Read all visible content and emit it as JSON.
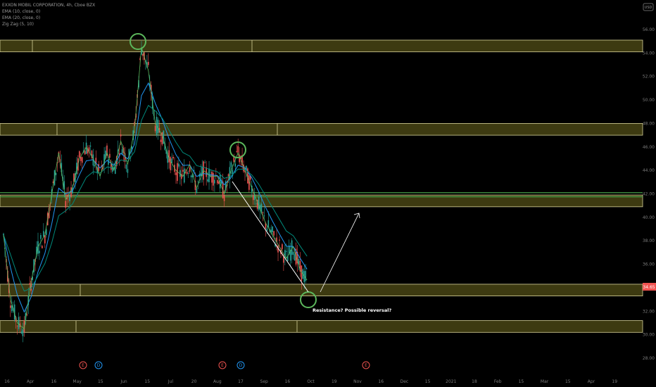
{
  "legend": {
    "symbol": "EXXON MOBIL CORPORATION, 4h, Cboe BZX",
    "ind1": "EMA (10, close, 0)",
    "ind2": "EMA (20, close, 0)",
    "ind3": "Zig Zag (5, 10)"
  },
  "currency_badge": "USD",
  "colors": {
    "zone_fill": "#3d3a11",
    "zone_border": "#d9d49a",
    "green_band": "#4caf50",
    "up_candle": "#26a69a",
    "down_candle": "#ef5350",
    "price_tag": "#ef5350",
    "zigzag": "#5cb85c",
    "ema1": "#2196f3",
    "ema2": "#00897b",
    "annotation": "#ffffff"
  },
  "chart_data": {
    "type": "candlestick",
    "title": "EXXON MOBIL CORPORATION, 4h, Cboe BZX",
    "ylim": [
      27,
      57.5
    ],
    "y_ticks": [
      "56.00",
      "54.00",
      "52.00",
      "50.00",
      "48.00",
      "46.00",
      "44.00",
      "42.00",
      "40.00",
      "38.00",
      "36.00",
      "34.00",
      "32.00",
      "30.00",
      "28.00"
    ],
    "x_ticks": [
      "16",
      "Apr",
      "16",
      "May",
      "15",
      "Jun",
      "15",
      "Jul",
      "20",
      "Aug",
      "17",
      "Sep",
      "16",
      "Oct",
      "19",
      "Nov",
      "16",
      "Dec",
      "15",
      "2021",
      "18",
      "Feb",
      "15",
      "Mar",
      "15",
      "Apr",
      "19"
    ],
    "last_price": "34.65",
    "price_path": [
      {
        "x": 0,
        "y": 38.5
      },
      {
        "x": 1,
        "y": 33.0
      },
      {
        "x": 2,
        "y": 31.0
      },
      {
        "x": 3,
        "y": 30.5
      },
      {
        "x": 4,
        "y": 34.5
      },
      {
        "x": 5,
        "y": 37.5
      },
      {
        "x": 6,
        "y": 38.5
      },
      {
        "x": 7,
        "y": 42.0
      },
      {
        "x": 8,
        "y": 45.5
      },
      {
        "x": 9,
        "y": 41.5
      },
      {
        "x": 10,
        "y": 42.5
      },
      {
        "x": 11,
        "y": 45.0
      },
      {
        "x": 12,
        "y": 46.0
      },
      {
        "x": 13,
        "y": 45.0
      },
      {
        "x": 14,
        "y": 43.5
      },
      {
        "x": 15,
        "y": 45.5
      },
      {
        "x": 16,
        "y": 44.0
      },
      {
        "x": 17,
        "y": 46.5
      },
      {
        "x": 18,
        "y": 44.5
      },
      {
        "x": 19,
        "y": 47.5
      },
      {
        "x": 20,
        "y": 54.5
      },
      {
        "x": 21,
        "y": 52.5
      },
      {
        "x": 22,
        "y": 48.0
      },
      {
        "x": 23,
        "y": 47.0
      },
      {
        "x": 24,
        "y": 45.0
      },
      {
        "x": 25,
        "y": 44.0
      },
      {
        "x": 26,
        "y": 43.5
      },
      {
        "x": 27,
        "y": 44.5
      },
      {
        "x": 28,
        "y": 42.5
      },
      {
        "x": 29,
        "y": 44.0
      },
      {
        "x": 30,
        "y": 43.5
      },
      {
        "x": 31,
        "y": 43.5
      },
      {
        "x": 32,
        "y": 42.0
      },
      {
        "x": 33,
        "y": 44.0
      },
      {
        "x": 34,
        "y": 45.5
      },
      {
        "x": 35,
        "y": 44.0
      },
      {
        "x": 36,
        "y": 42.5
      },
      {
        "x": 37,
        "y": 41.0
      },
      {
        "x": 38,
        "y": 39.5
      },
      {
        "x": 39,
        "y": 38.5
      },
      {
        "x": 40,
        "y": 37.5
      },
      {
        "x": 41,
        "y": 36.5
      },
      {
        "x": 42,
        "y": 37.5
      },
      {
        "x": 43,
        "y": 35.5
      },
      {
        "x": 44,
        "y": 34.65
      }
    ],
    "zones": [
      {
        "top": 55.1,
        "bottom": 54.1
      },
      {
        "top": 48.0,
        "bottom": 47.0
      },
      {
        "top": 41.9,
        "bottom": 40.9
      },
      {
        "top": 34.3,
        "bottom": 33.3
      },
      {
        "top": 31.2,
        "bottom": 30.2
      }
    ],
    "green_line_levels": [
      42.1,
      41.75
    ],
    "circled_points": [
      {
        "x": "Jun",
        "y": 55.0
      },
      {
        "x": "Aug 17",
        "y": 46.3
      },
      {
        "x": "Sep 16",
        "y": 34.0
      }
    ],
    "projection": {
      "from": 34.2,
      "to": 41.2
    },
    "annotation": "Resistance? Possible reversal?",
    "events": [
      "E",
      "D",
      "E",
      "D",
      "E"
    ]
  }
}
